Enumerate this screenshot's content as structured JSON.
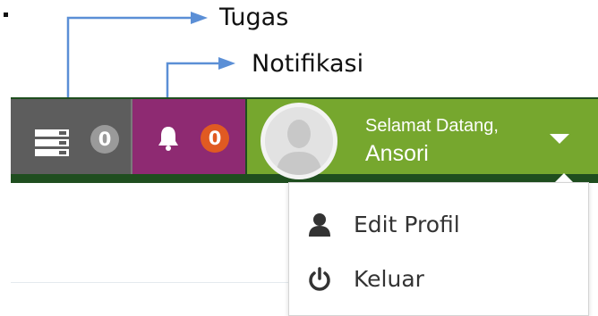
{
  "annotations": {
    "tasks_label": "Tugas",
    "notifications_label": "Notifikasi"
  },
  "header": {
    "tasks": {
      "icon": "tasks-icon",
      "count": "0",
      "color": "#5d5d5d"
    },
    "notifications": {
      "icon": "bell-icon",
      "count": "0",
      "color": "#8e2a72",
      "badge_color": "#e05a22"
    },
    "user": {
      "greeting": "Selamat Datang,",
      "name": "Ansori",
      "avatar": "user-avatar-placeholder",
      "color": "#76a72e"
    },
    "bar_color": "#1f4e1f"
  },
  "dropdown": {
    "items": [
      {
        "label": "Edit Profil",
        "icon": "user-icon"
      },
      {
        "label": "Keluar",
        "icon": "power-icon"
      }
    ]
  }
}
